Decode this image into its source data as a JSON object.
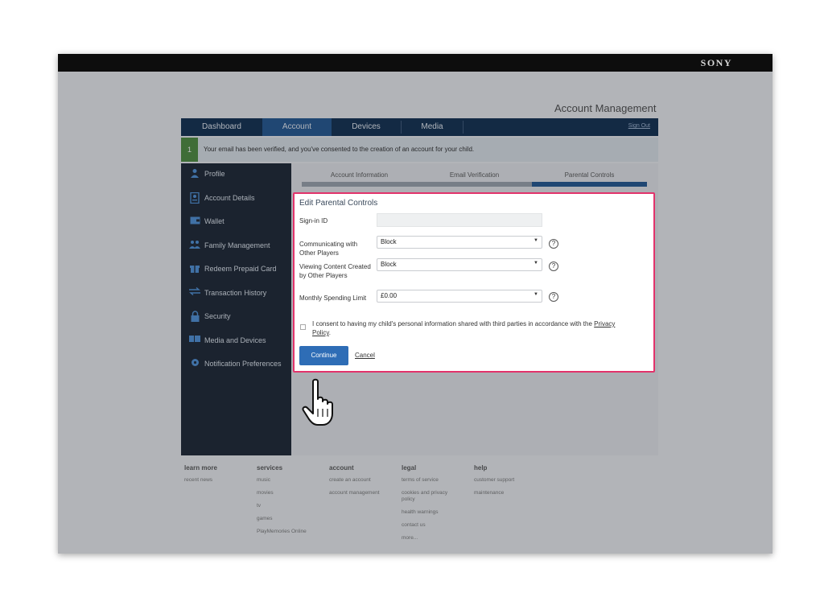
{
  "brand": "SONY",
  "account_title": "Account Management",
  "nav": {
    "tabs": [
      {
        "label": "Dashboard"
      },
      {
        "label": "Account"
      },
      {
        "label": "Devices"
      },
      {
        "label": "Media"
      }
    ],
    "active_tab": "Account",
    "sign_out": "Sign Out"
  },
  "banner": {
    "number": "1",
    "text": "Your email has been verified, and you've consented to the creation of an account for your child."
  },
  "sidebar": {
    "items": [
      {
        "label": "Profile",
        "icon": "person-icon"
      },
      {
        "label": "Account Details",
        "icon": "id-card-icon"
      },
      {
        "label": "Wallet",
        "icon": "wallet-icon"
      },
      {
        "label": "Family Management",
        "icon": "family-icon"
      },
      {
        "label": "Redeem Prepaid Card",
        "icon": "gift-icon"
      },
      {
        "label": "Transaction History",
        "icon": "transfer-icon"
      },
      {
        "label": "Security",
        "icon": "lock-icon"
      },
      {
        "label": "Media and Devices",
        "icon": "media-icon"
      },
      {
        "label": "Notification Preferences",
        "icon": "gear-icon"
      }
    ]
  },
  "steps": {
    "items": [
      {
        "label": "Account Information"
      },
      {
        "label": "Email Verification"
      },
      {
        "label": "Parental Controls"
      }
    ],
    "active_step": "Parental Controls"
  },
  "form": {
    "title": "Edit Parental Controls",
    "signin_label": "Sign-in ID",
    "signin_value": "",
    "communicating_label": "Communicating with Other Players",
    "communicating_value": "Block",
    "viewing_label": "Viewing Content Created by Other Players",
    "viewing_value": "Block",
    "spending_label": "Monthly Spending Limit",
    "spending_value": "£0.00",
    "help_symbol": "?",
    "consent_text": "I consent to having my child's personal information shared with third parties in accordance with the",
    "consent_link": "Privacy Policy",
    "consent_end": ".",
    "continue_label": "Continue",
    "cancel_label": "Cancel"
  },
  "footer": {
    "columns": [
      {
        "heading": "learn more",
        "links": [
          "recent news"
        ]
      },
      {
        "heading": "services",
        "links": [
          "music",
          "movies",
          "tv",
          "games",
          "PlayMemories Online"
        ]
      },
      {
        "heading": "account",
        "links": [
          "create an account",
          "account management"
        ]
      },
      {
        "heading": "legal",
        "links": [
          "terms of service",
          "cookies and privacy policy",
          "health warnings",
          "contact us",
          "more..."
        ]
      },
      {
        "heading": "help",
        "links": [
          "customer support",
          "maintenance"
        ]
      }
    ]
  },
  "colors": {
    "nav_bg": "#0b2a4d",
    "nav_active": "#1e5390",
    "highlight_border": "#e2336b",
    "primary_button": "#2e6db6",
    "banner_badge": "#4a8a3a"
  }
}
